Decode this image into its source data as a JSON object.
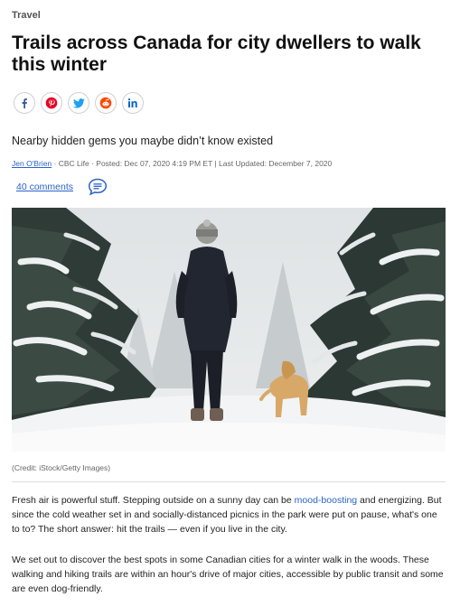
{
  "section": "Travel",
  "headline": "Trails across Canada for city dwellers to walk this winter",
  "share": [
    {
      "icon": "facebook-icon",
      "color": "#3b5998"
    },
    {
      "icon": "pinterest-icon",
      "color": "#e60023"
    },
    {
      "icon": "twitter-icon",
      "color": "#1da1f2"
    },
    {
      "icon": "reddit-icon",
      "color": "#ff4500"
    },
    {
      "icon": "linkedin-icon",
      "color": "#0a66c2"
    }
  ],
  "dek": "Nearby hidden gems you maybe didn’t know existed",
  "byline": {
    "author": "Jen O'Brien",
    "rest": " · CBC Life · Posted: Dec 07, 2020 4:19 PM ET | Last Updated: December 7, 2020"
  },
  "comments": {
    "label": "40 comments"
  },
  "photo": {
    "credit": "(Credit: iStock/Getty Images)"
  },
  "body": {
    "p1_before": "Fresh air is powerful stuff. Stepping outside on a sunny day can be ",
    "p1_link": "mood-boosting",
    "p1_after": " and energizing. But since the cold weather set in and socially-distanced picnics in the park were put on pause, what's one to to? The short answer: hit the trails — even if you live in the city.",
    "p2": "We set out to discover the best spots in some Canadian cities for a winter walk in the woods. These walking and hiking trails are within an hour's drive of major cities, accessible by public transit and some are even dog-friendly."
  },
  "colors": {
    "link": "#2a63c7",
    "share_border": "#cfcfcf"
  }
}
